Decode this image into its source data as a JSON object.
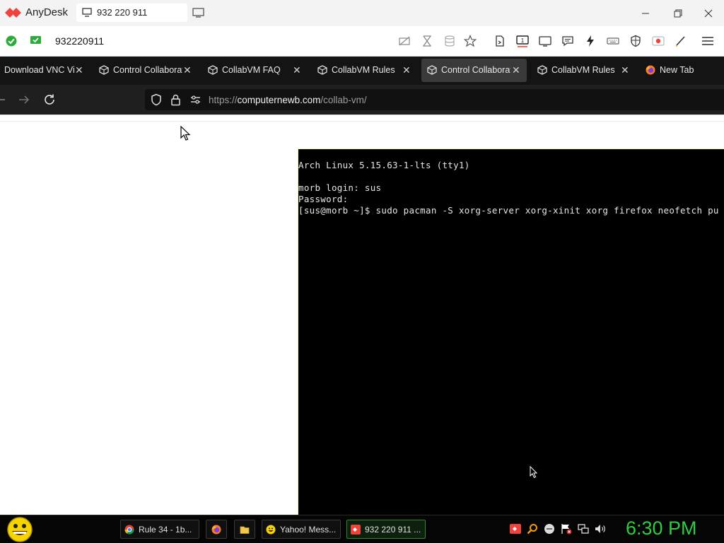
{
  "anydesk": {
    "app_name": "AnyDesk",
    "session_tab_label": "932 220 911",
    "address_value": "932220911",
    "accent_color": "#ef443b",
    "status_color": "#2eaa3c",
    "toolbar_icons": [
      "keyboard-crossed-icon",
      "hourglass-icon",
      "database-icon",
      "star-icon",
      "file-transfer-icon",
      "monitor-1-icon",
      "display-icon",
      "chat-icon",
      "lightning-icon",
      "keyboard-icon",
      "shield-icon",
      "record-icon",
      "pen-icon",
      "menu-icon"
    ]
  },
  "browser": {
    "tabs": [
      {
        "label": "Download VNC Vi",
        "icon": "download-icon",
        "active": false
      },
      {
        "label": "Control Collaborat",
        "icon": "collabvm-icon",
        "active": false
      },
      {
        "label": "CollabVM FAQ",
        "icon": "collabvm-icon",
        "active": false
      },
      {
        "label": "CollabVM Rules",
        "icon": "collabvm-icon",
        "active": false
      },
      {
        "label": "Control Collaborat",
        "icon": "collabvm-icon",
        "active": true
      },
      {
        "label": "CollabVM Rules",
        "icon": "collabvm-icon",
        "active": false
      },
      {
        "label": "New Tab",
        "icon": "firefox-icon",
        "active": false
      }
    ],
    "url_prefix": "https://",
    "url_domain": "computernewb.com",
    "url_path": "/collab-vm/"
  },
  "terminal": {
    "lines": [
      "Arch Linux 5.15.63-1-lts (tty1)",
      "",
      "morb login: sus",
      "Password:",
      "[sus@morb ~]$ sudo pacman -S xorg-server xorg-xinit xorg firefox neofetch pu"
    ]
  },
  "taskbar": {
    "items": [
      {
        "label": "Rule 34 - 1b...",
        "icon": "chrome-icon"
      },
      {
        "label": "",
        "icon": "firefox-icon"
      },
      {
        "label": "",
        "icon": "folder-icon"
      },
      {
        "label": "Yahoo! Mess...",
        "icon": "yahoo-messenger-icon"
      },
      {
        "label": "932 220 911 ...",
        "icon": "anydesk-icon"
      }
    ],
    "clock": "6:30 PM",
    "clock_color": "#2ecc40"
  }
}
